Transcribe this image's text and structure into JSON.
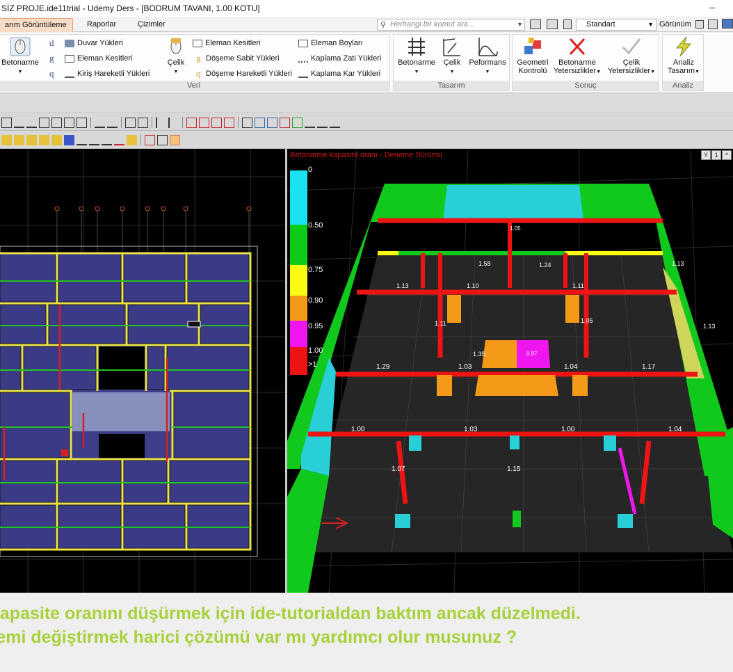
{
  "window": {
    "title": "SİZ PROJE.ide11trial - Udemy Ders - [BODRUM TAVANI,  1.00 KOTU]",
    "minimize": "–"
  },
  "tabs": [
    {
      "label": "arım Görüntüleme",
      "active": true
    },
    {
      "label": "Raporlar",
      "active": false
    },
    {
      "label": "Çizimler",
      "active": false
    }
  ],
  "command_search": {
    "placeholder": "Herhangi bir komut ara..."
  },
  "standard_select": {
    "value": "Standart"
  },
  "view_menu": {
    "label": "Görünüm"
  },
  "ribbon": {
    "veri": {
      "label": "Veri",
      "betonarme": "Betonarme",
      "celik": "Çelik",
      "letters": [
        "d",
        "g",
        "q"
      ],
      "col1": [
        "Duvar Yükleri",
        "Eleman Kesitleri",
        "Kiriş Hareketli Yükleri"
      ],
      "col2": [
        "Eleman Kesitleri",
        "Döşeme Sabit Yükleri",
        "Döşeme Hareketli Yükleri"
      ],
      "col2_letters": [
        "g",
        "q"
      ],
      "col3": [
        "Eleman Boyları",
        "Kaplama Zati  Yükleri",
        "Kaplama Kar Yükleri"
      ]
    },
    "tasarim": {
      "label": "Tasarım",
      "buttons": [
        "Betonarme",
        "Çelik",
        "Peformans"
      ]
    },
    "sonuc": {
      "label": "Sonuç",
      "buttons": [
        {
          "line1": "Geometri",
          "line2": "Kontrolü"
        },
        {
          "line1": "Betonarme",
          "line2": "Yetersizlikler"
        },
        {
          "line1": "Çelik",
          "line2": "Yetersizlikler"
        }
      ]
    },
    "analiz": {
      "label": "Analiz",
      "button": {
        "line1": "Analiz",
        "line2": "Tasarım"
      }
    }
  },
  "viewport_3d": {
    "title": "Betonarme kapasite oranı - Deneme Sürümü",
    "buttons": [
      "Y",
      "1",
      "^"
    ],
    "legend": [
      {
        "label": "0",
        "color": "#19e3ef"
      },
      {
        "label": "0.50",
        "color": "#0ccc16"
      },
      {
        "label": "0.75",
        "color": "#fafa13"
      },
      {
        "label": "0.90",
        "color": "#f59a18"
      },
      {
        "label": "0.95",
        "color": "#ef16ef"
      },
      {
        "label": "1.00",
        "color": "#ee1414"
      },
      {
        "label": ">1",
        "color": "#ee1414"
      }
    ],
    "values": [
      "1.13",
      "1.10",
      "1.11",
      "1.13",
      "1.58",
      "1.24",
      "1.05",
      "1.11",
      "1.35",
      "1.29",
      "1.03",
      "1.04",
      "1.17",
      "1.00",
      "1.03",
      "1.00",
      "1.04",
      "1.07",
      "1.15",
      "0.97",
      "1.13",
      "1.05"
    ]
  },
  "comment": {
    "line1": "kapasite oranını düşürmek için ide-tutorialdan baktım ancak düzelmedi.",
    "line2": "temi değiştirmek harici çözümü var mı yardımcı olur musunuz ?"
  }
}
